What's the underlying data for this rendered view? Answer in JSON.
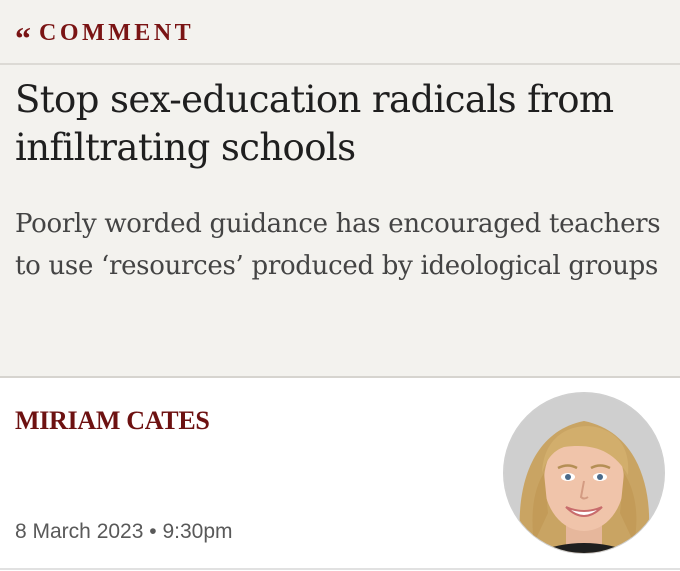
{
  "section": {
    "label": "COMMENT",
    "icon": "quote-icon"
  },
  "article": {
    "headline": "Stop sex-education radicals from infiltrating schools",
    "standfirst": "Poorly worded guidance has encouraged teachers to use ‘resources’ produced by ideological groups",
    "author": "MIRIAM CATES",
    "date": "8 March 2023",
    "time": "9:30pm",
    "separator": "•"
  },
  "colors": {
    "accent": "#7a1414",
    "background_top": "#f3f2ee",
    "headline": "#1f1f1f",
    "standfirst": "#444444"
  }
}
